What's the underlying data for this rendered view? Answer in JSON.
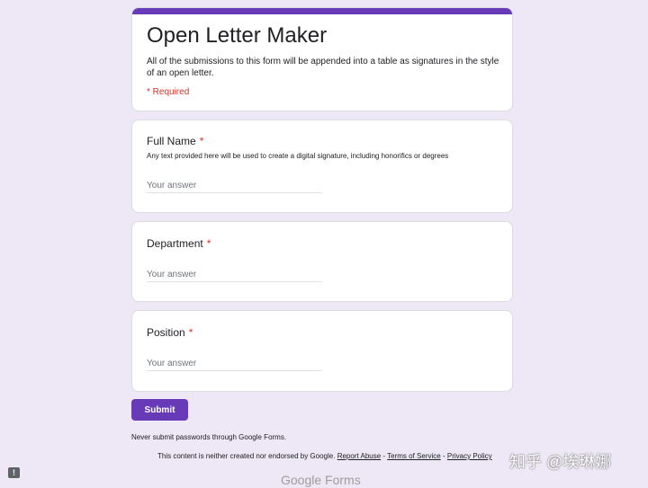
{
  "form": {
    "title": "Open Letter Maker",
    "description": "All of the submissions to this form will be appended into a table as signatures in the style of an open letter.",
    "required_note": "* Required"
  },
  "questions": [
    {
      "label": "Full Name",
      "star": "*",
      "help": "Any text provided here will be used to create a digital signature, including honorifics or degrees",
      "placeholder": "Your answer"
    },
    {
      "label": "Department",
      "star": "*",
      "placeholder": "Your answer"
    },
    {
      "label": "Position",
      "star": "*",
      "placeholder": "Your answer"
    }
  ],
  "submit_label": "Submit",
  "warning": "Never submit passwords through Google Forms.",
  "footer": {
    "text": "This content is neither created nor endorsed by Google.",
    "report_abuse": "Report Abuse",
    "sep1": "-",
    "terms": "Terms of Service",
    "sep2": "-",
    "privacy": "Privacy Policy"
  },
  "logo": {
    "google": "Google",
    "forms": "Forms"
  },
  "feedback_icon": "!",
  "watermark": "知乎 @埃琳娜",
  "colors": {
    "accent": "#673ab7",
    "background": "#ede7f6",
    "required": "#d93025"
  }
}
